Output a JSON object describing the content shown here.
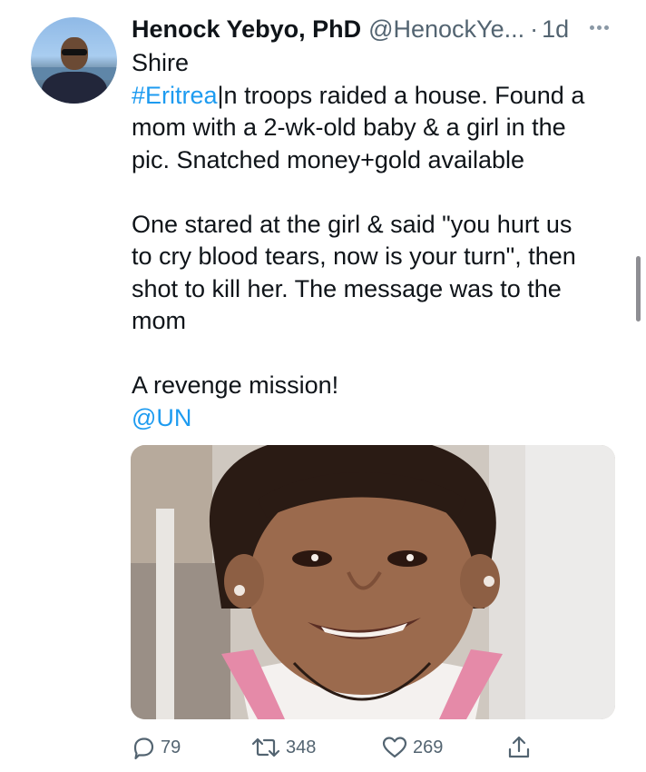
{
  "tweet": {
    "author_name": "Henock Yebyo, PhD",
    "handle": "@HenockYe...",
    "separator": "·",
    "time": "1d",
    "lines": [
      {
        "parts": [
          {
            "text": "Shire",
            "link": false
          }
        ]
      },
      {
        "parts": [
          {
            "text": "#Eritrea",
            "link": true
          },
          {
            "text": "|n troops raided a house. Found a",
            "link": false
          }
        ]
      },
      {
        "parts": [
          {
            "text": "mom with a 2-wk-old baby & a girl in the",
            "link": false
          }
        ]
      },
      {
        "parts": [
          {
            "text": "pic. Snatched money+gold available",
            "link": false
          }
        ]
      },
      {
        "blank": true
      },
      {
        "parts": [
          {
            "text": "One stared at the girl & said \"you hurt us",
            "link": false
          }
        ]
      },
      {
        "parts": [
          {
            "text": "to cry blood tears, now is your turn\", then",
            "link": false
          }
        ]
      },
      {
        "parts": [
          {
            "text": "shot to kill her. The message was to the",
            "link": false
          }
        ]
      },
      {
        "parts": [
          {
            "text": "mom",
            "link": false
          }
        ]
      },
      {
        "blank": true
      },
      {
        "parts": [
          {
            "text": "A revenge mission!",
            "link": false
          }
        ]
      },
      {
        "parts": [
          {
            "text": "@UN",
            "link": true
          }
        ]
      }
    ]
  },
  "actions": {
    "replies": "79",
    "retweets": "348",
    "likes": "269"
  },
  "icons": {
    "more": "more-options-icon",
    "reply": "reply-icon",
    "retweet": "retweet-icon",
    "like": "heart-icon",
    "share": "share-icon"
  },
  "colors": {
    "link": "#1d9bf0",
    "secondary_text": "#536471",
    "text": "#0f1419"
  }
}
